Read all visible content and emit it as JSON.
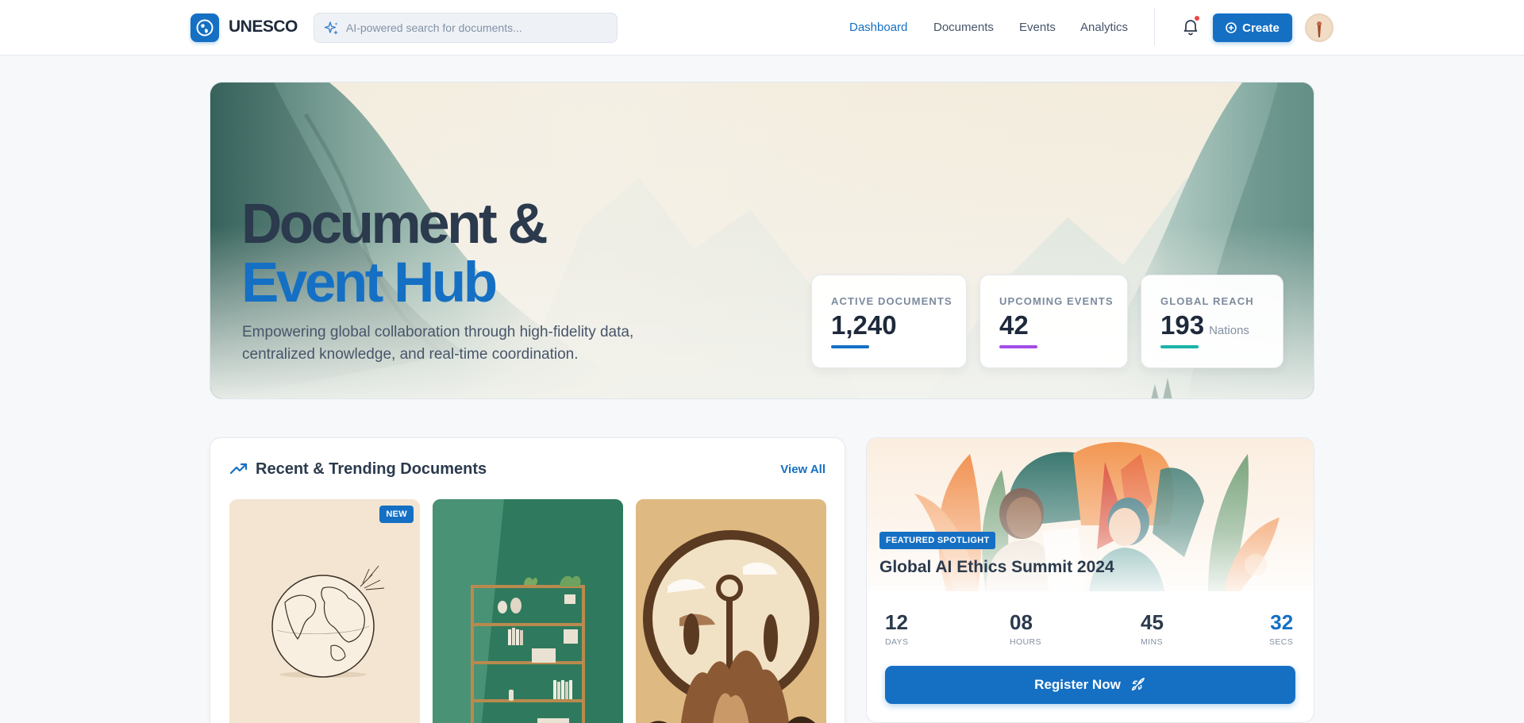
{
  "brand": {
    "name": "UNESCO"
  },
  "search": {
    "placeholder": "AI-powered search for documents..."
  },
  "nav": {
    "links": [
      {
        "label": "Dashboard",
        "active": true
      },
      {
        "label": "Documents",
        "active": false
      },
      {
        "label": "Events",
        "active": false
      },
      {
        "label": "Analytics",
        "active": false
      }
    ],
    "create_label": "Create",
    "notification_unread": true
  },
  "hero": {
    "title_line1": "Document &",
    "title_line2": "Event Hub",
    "subtitle": "Empowering global collaboration through high-fidelity data, centralized knowledge, and real-time coordination.",
    "stats": [
      {
        "label": "ACTIVE DOCUMENTS",
        "value": "1,240",
        "unit": "",
        "accent": "#1570c4"
      },
      {
        "label": "UPCOMING EVENTS",
        "value": "42",
        "unit": "",
        "accent": "#a24de8"
      },
      {
        "label": "GLOBAL REACH",
        "value": "193",
        "unit": "Nations",
        "accent": "#1bb3a8"
      }
    ]
  },
  "documents": {
    "title": "Recent & Trending Documents",
    "view_all_label": "View All",
    "items": [
      {
        "thumbnail": "globe-sketch",
        "badge": "NEW"
      },
      {
        "thumbnail": "bookshelf"
      },
      {
        "thumbnail": "abstract-landscape"
      }
    ]
  },
  "event": {
    "badge": "FEATURED SPOTLIGHT",
    "title": "Global AI Ethics Summit 2024",
    "countdown": [
      {
        "value": "12",
        "label": "DAYS"
      },
      {
        "value": "08",
        "label": "HOURS"
      },
      {
        "value": "45",
        "label": "MINS"
      },
      {
        "value": "32",
        "label": "SECS"
      }
    ],
    "register_label": "Register Now"
  },
  "colors": {
    "primary": "#1570c4",
    "heading": "#2b3a4d",
    "events_accent": "#a24de8",
    "reach_accent": "#1bb3a8"
  }
}
